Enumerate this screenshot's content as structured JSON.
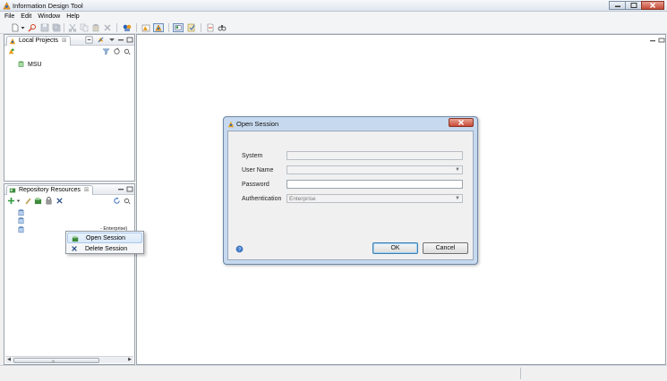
{
  "window": {
    "title": "Information Design Tool"
  },
  "menu": {
    "items": [
      "File",
      "Edit",
      "Window",
      "Help"
    ]
  },
  "local_projects": {
    "tab_label": "Local Projects",
    "tab_close": "☒",
    "items": [
      {
        "label": "MSU"
      }
    ]
  },
  "repository_resources": {
    "tab_label": "Repository Resources",
    "tab_close": "☒",
    "sessions": [
      {
        "label": ""
      },
      {
        "label": ""
      },
      {
        "label": "- Enterprise)"
      }
    ],
    "scroll_grip": "III"
  },
  "context_menu": {
    "items": [
      {
        "label": "Open Session",
        "highlighted": true
      },
      {
        "label": "Delete Session",
        "highlighted": false
      }
    ]
  },
  "dialog": {
    "title": "Open Session",
    "fields": {
      "system_label": "System",
      "system_value": "",
      "username_label": "User Name",
      "username_value": "",
      "password_label": "Password",
      "password_value": "",
      "auth_label": "Authentication",
      "auth_value": "Enterprise"
    },
    "ok_label": "OK",
    "cancel_label": "Cancel"
  },
  "colors": {
    "dialog_frame": "#c7d9ee",
    "highlight": "#d9e8f8",
    "close_red": "#c84a36"
  }
}
